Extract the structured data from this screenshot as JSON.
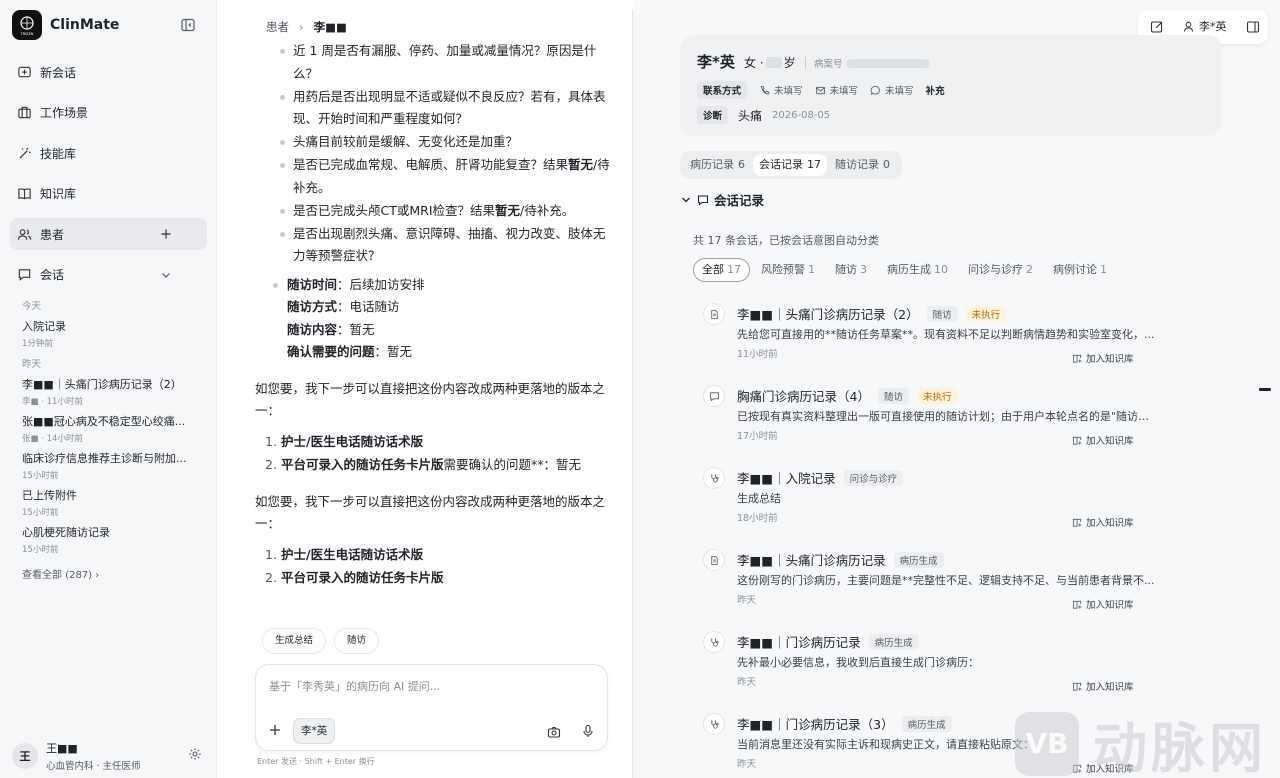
{
  "app": {
    "logo_text": "TRIZEN",
    "name": "ClinMate"
  },
  "sidebar": {
    "nav": [
      {
        "label": "新会话",
        "icon": "new-chat-icon"
      },
      {
        "label": "工作场景",
        "icon": "briefcase-icon"
      },
      {
        "label": "技能库",
        "icon": "magic-wand-icon"
      },
      {
        "label": "知识库",
        "icon": "book-icon"
      },
      {
        "label": "患者",
        "icon": "users-icon"
      },
      {
        "label": "会话",
        "icon": "chat-icon"
      }
    ],
    "groups": {
      "today": "今天",
      "yesterday": "昨天"
    },
    "sessions": [
      {
        "title": "入院记录",
        "meta": "1分钟前"
      },
      {
        "title": "李■■｜头痛门诊病历记录（2）",
        "meta": "李■ · 11小时前"
      },
      {
        "title": "张■■冠心病及不稳定型心绞痛...",
        "meta": "张■ · 14小时前"
      },
      {
        "title": "临床诊疗信息推荐主诊断与附加...",
        "meta": "15小时前"
      },
      {
        "title": "已上传附件",
        "meta": "15小时前"
      },
      {
        "title": "心肌梗死随访记录",
        "meta": "15小时前"
      }
    ],
    "view_all": "查看全部 (287)",
    "user": {
      "avatar": "王",
      "name": "王■■",
      "dept": "心血管内科 · 主任医师"
    }
  },
  "chat": {
    "breadcrumb": {
      "root": "患者",
      "current": "李■■"
    },
    "questions": [
      "近 1 周是否有漏服、停药、加量或减量情况？原因是什么？",
      "用药后是否出现明显不适或疑似不良反应？若有，具体表现、开始时间和严重程度如何？",
      "头痛目前较前是缓解、无变化还是加重？",
      {
        "a": "是否已完成血常规、电解质、肝肾功能复查？结果",
        "b": "暂无",
        "c": "/待补充。"
      },
      {
        "a": "是否已完成头颅CT或MRI检查？结果",
        "b": "暂无",
        "c": "/待补充。"
      },
      "是否出现剧烈头痛、意识障碍、抽搐、视力改变、肢体无力等预警症状？"
    ],
    "followup": [
      {
        "k": "随访时间",
        "v": "：后续加访安排"
      },
      {
        "k": "随访方式",
        "v": "：电话随访"
      },
      {
        "k": "随访内容",
        "v": "：暂无"
      },
      {
        "k": "确认需要的问题",
        "v": "：暂无"
      }
    ],
    "para": "如您要，我下一步可以直接把这份内容改成两种更落地的版本之一：",
    "list1": [
      {
        "n": "1.",
        "b": "护士/医生电话随访话术版",
        "t": ""
      },
      {
        "n": "2.",
        "b": "平台可录入的随访任务卡片版",
        "t": "需要确认的问题**：暂无"
      }
    ],
    "list2": [
      {
        "n": "1.",
        "b": "护士/医生电话随访话术版",
        "t": ""
      },
      {
        "n": "2.",
        "b": "平台可录入的随访任务卡片版",
        "t": ""
      }
    ],
    "chips": [
      "生成总结",
      "随访"
    ],
    "composer": {
      "placeholder": "基于「李秀英」的病历向 AI 提问...",
      "patient_chip": "李*英"
    },
    "hint": "Enter 发送 · Shift + Enter 换行"
  },
  "right": {
    "topbar_user": "李*英",
    "patient": {
      "name": "李*英",
      "gender": "女 · ",
      "age_unit": "岁",
      "case_label": "病案号",
      "contact_label": "联系方式",
      "phone": "未填写",
      "email": "未填写",
      "wechat": "未填写",
      "supplement": "补充",
      "dx_label": "诊断",
      "dx_name": "头痛",
      "dx_date": "2026-08-05"
    },
    "tabs": [
      {
        "label": "病历记录",
        "count": "6"
      },
      {
        "label": "会话记录",
        "count": "17"
      },
      {
        "label": "随访记录",
        "count": "0"
      }
    ],
    "section_title": "会话记录",
    "summary": "共 17 条会话，已按会话意图自动分类",
    "filters": [
      {
        "label": "全部",
        "count": "17"
      },
      {
        "label": "风险预警",
        "count": "1"
      },
      {
        "label": "随访",
        "count": "3"
      },
      {
        "label": "病历生成",
        "count": "10"
      },
      {
        "label": "问诊与诊疗",
        "count": "2"
      },
      {
        "label": "病例讨论",
        "count": "1"
      }
    ],
    "kb_label": "加入知识库",
    "records": [
      {
        "icon": "document-icon",
        "title": "李■■｜头痛门诊病历记录（2）",
        "tag": "随访",
        "status": "未执行",
        "summary": "先给您可直接用的**随访任务草案**。现有资料不足以判断病情趋势和实验室变化，...",
        "time": "11小时前"
      },
      {
        "icon": "chat-bubble-icon",
        "title": "胸痛门诊病历记录（4）",
        "tag": "随访",
        "status": "未执行",
        "summary": "已按现有真实资料整理出一版可直接使用的随访计划；由于用户本轮点名的是\"随访总...",
        "time": "17小时前"
      },
      {
        "icon": "stethoscope-icon",
        "title": "李■■｜入院记录",
        "tag": "问诊与诊疗",
        "status": "",
        "summary": "生成总结",
        "time": "18小时前"
      },
      {
        "icon": "document-icon",
        "title": "李■■｜头痛门诊病历记录",
        "tag": "病历生成",
        "status": "",
        "summary": "这份刚写的门诊病历，主要问题是**完整性不足、逻辑支持不足、与当前患者背景不...",
        "time": "昨天"
      },
      {
        "icon": "stethoscope-icon",
        "title": "李■■｜门诊病历记录",
        "tag": "病历生成",
        "status": "",
        "summary": "先补最小必要信息，我收到后直接生成门诊病历：",
        "time": "昨天"
      },
      {
        "icon": "stethoscope-icon",
        "title": "李■■｜门诊病历记录（3）",
        "tag": "病历生成",
        "status": "",
        "summary": "当前消息里还没有实际主诉和现病史正文，请直接粘贴原文：",
        "time": "昨天"
      }
    ]
  },
  "watermark": {
    "logo": "VB",
    "text": "动脉网"
  }
}
